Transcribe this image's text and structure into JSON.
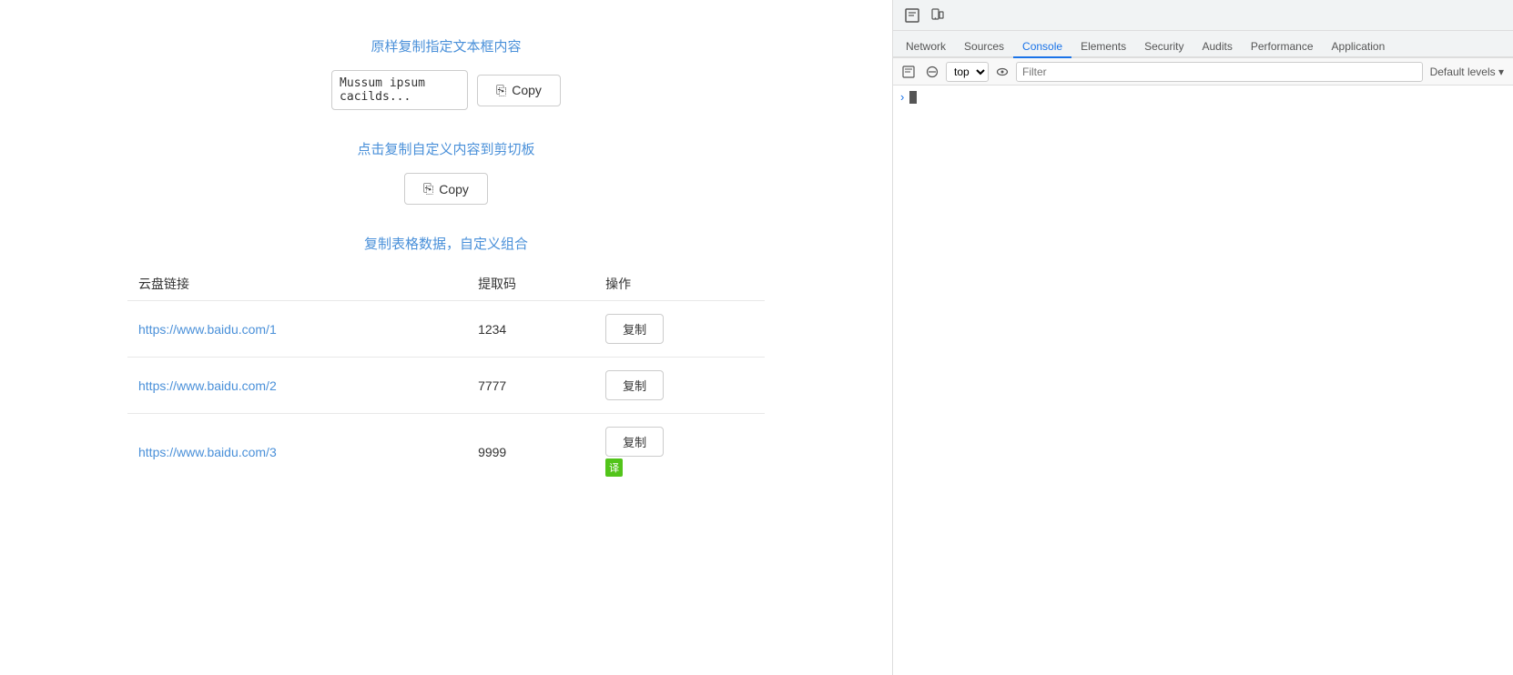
{
  "main": {
    "section1": {
      "title": "原样复制指定文本框内容",
      "input_value": "Mussum ipsum cacilds...",
      "copy_button_label": "Copy"
    },
    "section2": {
      "title": "点击复制自定义内容到剪切板",
      "copy_button_label": "Copy"
    },
    "section3": {
      "title": "复制表格数据，自定义组合",
      "columns": [
        "云盘链接",
        "提取码",
        "操作"
      ],
      "rows": [
        {
          "link": "https://www.baidu.com/1",
          "code": "1234",
          "action": "复制"
        },
        {
          "link": "https://www.baidu.com/2",
          "code": "7777",
          "action": "复制"
        },
        {
          "link": "https://www.baidu.com/3",
          "code": "9999",
          "action": "复制",
          "badge": "译"
        }
      ]
    }
  },
  "devtools": {
    "toolbar_icons": [
      "inspect",
      "device"
    ],
    "tabs": [
      "Network",
      "Sources",
      "Console",
      "Elements",
      "Security",
      "Audits",
      "Performance",
      "Application"
    ],
    "active_tab": "Console",
    "context": "top",
    "filter_placeholder": "Filter",
    "default_levels": "Default levels",
    "console_arrow": "›"
  }
}
